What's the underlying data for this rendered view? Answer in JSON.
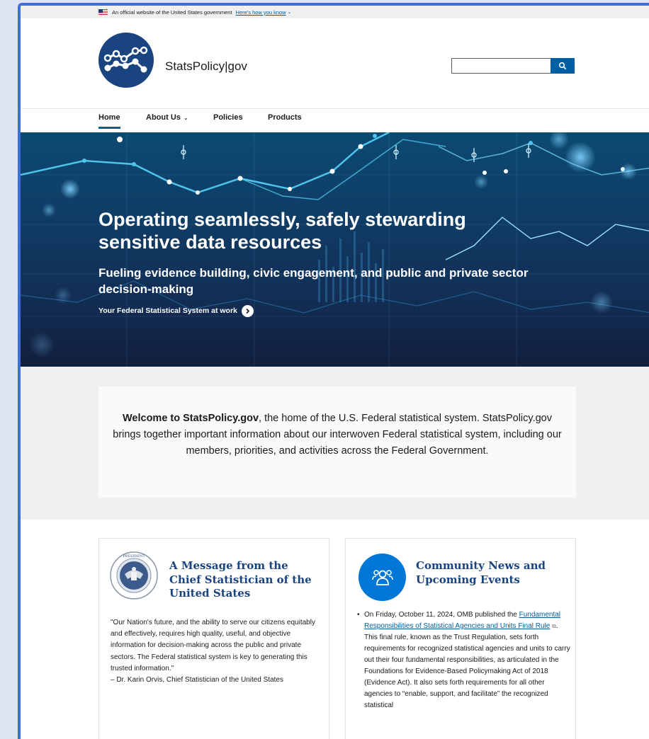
{
  "gov_banner": {
    "text": "An official website of the United States government",
    "link": "Here's how you know"
  },
  "header": {
    "site_name_a": "StatsPolicy",
    "site_name_sep": "|",
    "site_name_b": "gov",
    "search": {
      "value": "",
      "placeholder": ""
    }
  },
  "nav": {
    "items": [
      {
        "label": "Home",
        "active": true
      },
      {
        "label": "About Us",
        "dropdown": true
      },
      {
        "label": "Policies"
      },
      {
        "label": "Products"
      }
    ]
  },
  "hero": {
    "title": "Operating seamlessly, safely stewarding sensitive data resources",
    "subtitle": "Fueling evidence building, civic engagement, and public and private sector decision-making",
    "cta": "Your Federal Statistical System at work"
  },
  "welcome": {
    "bold": "Welcome to StatsPolicy.gov",
    "text": ", the home of the U.S. Federal statistical system. StatsPolicy.gov brings together important information about our interwoven Federal statistical system, including our members, priorities, and activities across the Federal Government."
  },
  "cards": {
    "message": {
      "title": "A Message from the Chief Statistician of the United States",
      "quote": "\"Our Nation's future, and the ability to serve our citizens equitably and effectively, requires high quality, useful, and objective information for decision-making across the public and private sectors. The Federal statistical system is key to generating this trusted information.\"",
      "attribution": "– Dr. Karin Orvis, Chief Statistician of the United States"
    },
    "news": {
      "title": "Community News and Upcoming Events",
      "item_prefix": "On Friday, October 11, 2024, OMB published the ",
      "item_link": "Fundamental Responsibilities of Statistical Agencies and Units Final Rule",
      "item_suffix": ". This final rule, known as the Trust Regulation, sets forth requirements for recognized statistical agencies and units to carry out their four fundamental responsibilities, as articulated in the Foundations for Evidence-Based Policymaking Act of 2018 (Evidence Act). It also sets forth requirements for all other agencies to “enable, support, and facilitate” the recognized statistical"
    }
  },
  "colors": {
    "primary": "#005ea2",
    "dark_blue": "#1a4480",
    "accent_blue": "#0076d6",
    "frame": "#3e6fd6"
  }
}
